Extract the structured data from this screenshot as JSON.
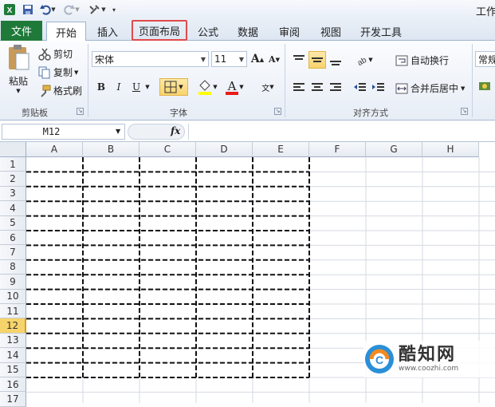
{
  "window": {
    "title": "工作"
  },
  "tabs": {
    "file": "文件",
    "home": "开始",
    "insert": "插入",
    "page_layout": "页面布局",
    "formulas": "公式",
    "data": "数据",
    "review": "审阅",
    "view": "视图",
    "developer": "开发工具"
  },
  "ribbon": {
    "clipboard": {
      "paste": "粘贴",
      "cut": "剪切",
      "copy": "复制",
      "format_painter": "格式刷",
      "label": "剪贴板"
    },
    "font": {
      "name": "宋体",
      "size": "11",
      "grow": "A",
      "shrink": "A",
      "bold": "B",
      "italic": "I",
      "underline": "U",
      "fill_color": "#ffff00",
      "font_color_letter": "A",
      "font_color": "#e81b1b",
      "phonetic": "wén",
      "label": "字体"
    },
    "alignment": {
      "wrap_text": "自动换行",
      "merge_center": "合并后居中",
      "label": "对齐方式"
    },
    "number": {
      "format": "常规"
    }
  },
  "formula_bar": {
    "name_box": "M12",
    "fx": "fx",
    "formula": ""
  },
  "sheet": {
    "columns": [
      "A",
      "B",
      "C",
      "D",
      "E",
      "F",
      "G",
      "H"
    ],
    "rows": [
      "1",
      "2",
      "3",
      "4",
      "5",
      "6",
      "7",
      "8",
      "9",
      "10",
      "11",
      "12",
      "13",
      "14",
      "15",
      "16",
      "17"
    ],
    "active_row": "12",
    "print_area_columns": [
      "A",
      "B",
      "C",
      "D",
      "E"
    ],
    "print_area_rows": 15
  },
  "watermark": {
    "name": "酷知网",
    "url": "www.coozhi.com"
  },
  "colors": {
    "file_tab": "#1f7a3a",
    "highlight": "#e04a4a",
    "active_header": "#f7d46b"
  }
}
